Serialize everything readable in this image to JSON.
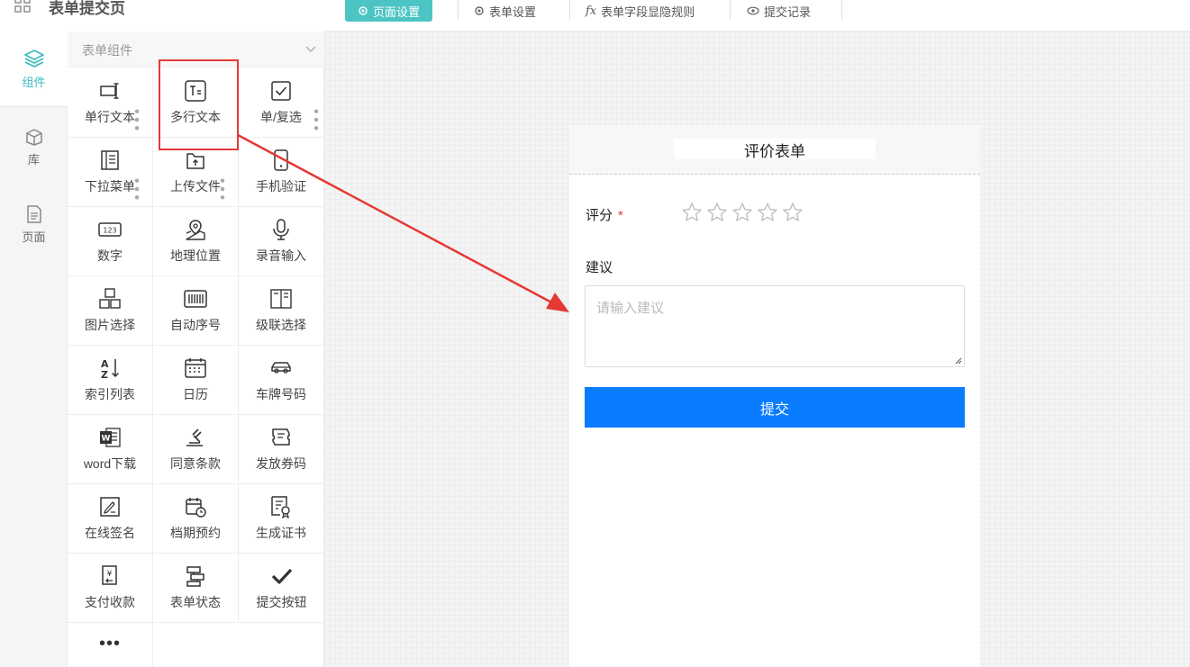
{
  "app": {
    "title": "表单提交页"
  },
  "toolbar": {
    "buttons": [
      {
        "label": "页面设置",
        "icon": "gear-icon",
        "active": true
      },
      {
        "label": "表单设置",
        "icon": "gear-icon"
      },
      {
        "label": "表单字段显隐规则",
        "icon": "fx-icon"
      },
      {
        "label": "提交记录",
        "icon": "eye-icon"
      }
    ]
  },
  "rail": {
    "items": [
      {
        "label": "组件",
        "icon": "layers-icon",
        "active": true
      },
      {
        "label": "库",
        "icon": "box-icon"
      },
      {
        "label": "页面",
        "icon": "document-icon"
      }
    ]
  },
  "panel": {
    "header": "表单组件",
    "components": [
      {
        "label": "单行文本",
        "icon": "single-line-text-icon"
      },
      {
        "label": "多行文本",
        "icon": "multi-line-text-icon"
      },
      {
        "label": "单/复选",
        "icon": "checkbox-icon"
      },
      {
        "label": "下拉菜单",
        "icon": "dropdown-icon"
      },
      {
        "label": "上传文件",
        "icon": "upload-file-icon"
      },
      {
        "label": "手机验证",
        "icon": "phone-icon"
      },
      {
        "label": "数字",
        "icon": "number-icon"
      },
      {
        "label": "地理位置",
        "icon": "map-pin-icon"
      },
      {
        "label": "录音输入",
        "icon": "microphone-icon"
      },
      {
        "label": "图片选择",
        "icon": "image-select-icon"
      },
      {
        "label": "自动序号",
        "icon": "barcode-icon"
      },
      {
        "label": "级联选择",
        "icon": "cascade-icon"
      },
      {
        "label": "索引列表",
        "icon": "sort-az-icon"
      },
      {
        "label": "日历",
        "icon": "calendar-icon"
      },
      {
        "label": "车牌号码",
        "icon": "car-icon"
      },
      {
        "label": "word下载",
        "icon": "word-icon"
      },
      {
        "label": "同意条款",
        "icon": "gavel-icon"
      },
      {
        "label": "发放券码",
        "icon": "ticket-icon"
      },
      {
        "label": "在线签名",
        "icon": "signature-icon"
      },
      {
        "label": "档期预约",
        "icon": "schedule-icon"
      },
      {
        "label": "生成证书",
        "icon": "certificate-icon"
      },
      {
        "label": "支付收款",
        "icon": "payment-icon"
      },
      {
        "label": "表单状态",
        "icon": "form-status-icon"
      },
      {
        "label": "提交按钮",
        "icon": "check-icon"
      }
    ],
    "more": "•••"
  },
  "form": {
    "title": "评价表单",
    "rating_label": "评分",
    "required_mark": "*",
    "rating_value": 0,
    "rating_max": 5,
    "suggestion_label": "建议",
    "suggestion_placeholder": "请输入建议",
    "submit_label": "提交"
  },
  "colors": {
    "accent": "#4dc4c4",
    "primary": "#0a7cff",
    "highlight": "#e53935"
  }
}
